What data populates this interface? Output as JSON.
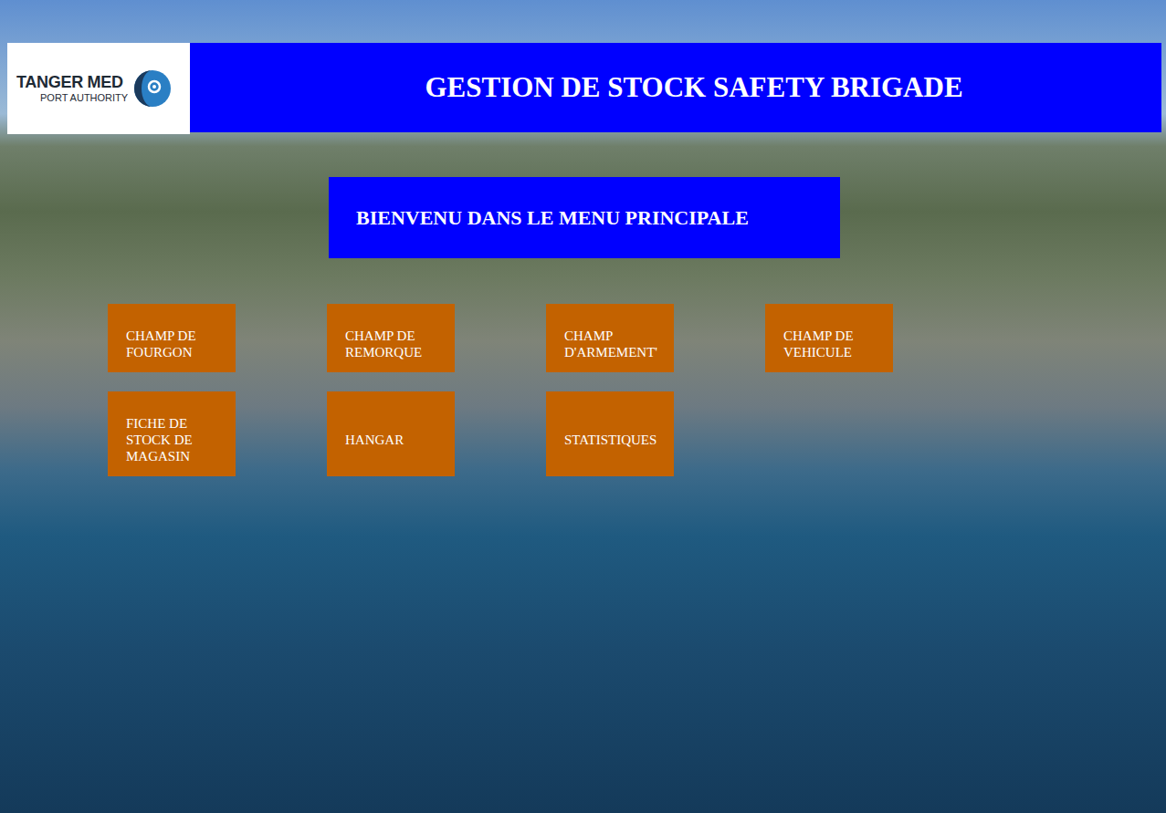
{
  "header": {
    "logo": {
      "name": "TANGER MED",
      "subtitle": "PORT AUTHORITY"
    },
    "title": "GESTION DE STOCK SAFETY BRIGADE"
  },
  "welcome": "BIENVENU DANS LE MENU PRINCIPALE",
  "menu_rows": [
    [
      {
        "label": "CHAMP DE FOURGON"
      },
      {
        "label": "CHAMP DE REMORQUE"
      },
      {
        "label": "CHAMP D'ARMEMENT'"
      },
      {
        "label": "CHAMP DE VEHICULE"
      }
    ],
    [
      {
        "label": "FICHE DE STOCK DE MAGASIN"
      },
      {
        "label": "HANGAR"
      },
      {
        "label": "STATISTIQUES"
      }
    ]
  ]
}
